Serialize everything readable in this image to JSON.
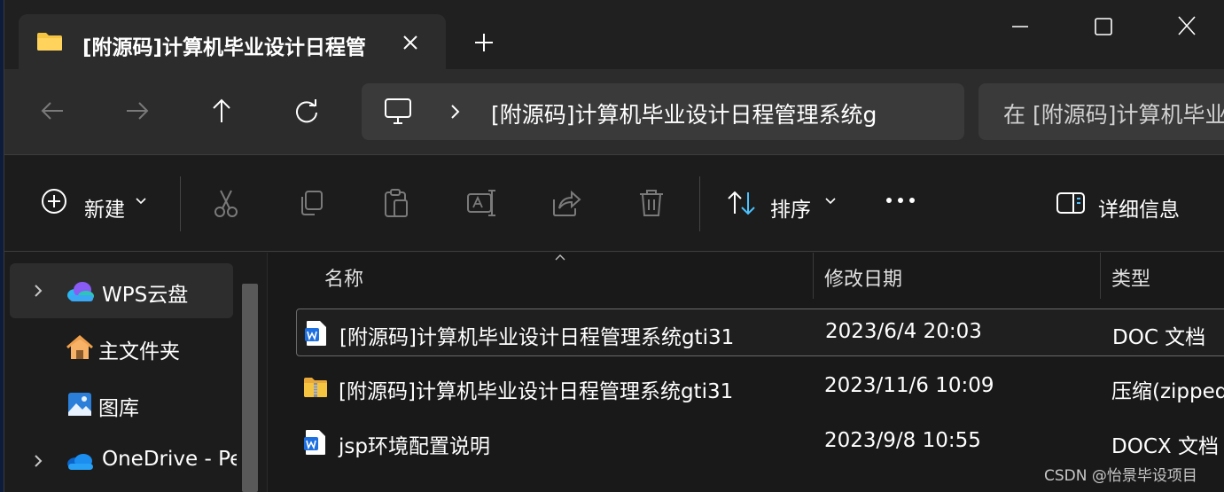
{
  "window": {
    "tab_title": "[附源码]计算机毕业设计日程管",
    "tab_icon": "folder-icon",
    "controls": [
      "minimize-icon",
      "maximize-icon",
      "close-icon"
    ]
  },
  "navigation": {
    "buttons": [
      "back-arrow-icon",
      "forward-arrow-icon",
      "up-arrow-icon",
      "refresh-icon"
    ],
    "address_path": "[附源码]计算机毕业设计日程管理系统g",
    "search_placeholder": "在 [附源码]计算机毕业"
  },
  "toolbar": {
    "new_label": "新建",
    "sort_label": "排序",
    "details_label": "详细信息",
    "actions": [
      "cut-icon",
      "copy-icon",
      "paste-icon",
      "rename-icon",
      "share-icon",
      "delete-icon"
    ]
  },
  "sidebar": {
    "items": [
      {
        "label": "WPS云盘",
        "icon": "cloud-icon",
        "expandable": true,
        "active": true
      },
      {
        "label": "主文件夹",
        "icon": "home-icon",
        "expandable": false,
        "active": false
      },
      {
        "label": "图库",
        "icon": "gallery-icon",
        "expandable": false,
        "active": false
      },
      {
        "label": "OneDrive - Pe",
        "icon": "onedrive-icon",
        "expandable": true,
        "active": false
      }
    ]
  },
  "filelist": {
    "columns": [
      "名称",
      "修改日期",
      "类型"
    ],
    "rows": [
      {
        "name": "[附源码]计算机毕业设计日程管理系统gti31",
        "date": "2023/6/4 20:03",
        "type": "DOC 文档",
        "icon": "word-doc-icon"
      },
      {
        "name": "[附源码]计算机毕业设计日程管理系统gti31",
        "date": "2023/11/6 10:09",
        "type": "压缩(zipped)",
        "icon": "zip-folder-icon"
      },
      {
        "name": "jsp环境配置说明",
        "date": "2023/9/8 10:55",
        "type": "DOCX 文档",
        "icon": "word-doc-icon"
      }
    ]
  },
  "watermark": "CSDN @怡景毕设项目",
  "colors": {
    "window_bg": "#1c1c1c",
    "address_bg": "#3a3a3a",
    "word_blue": "#1e6fe0",
    "folder_yellow": "#f5c542"
  }
}
